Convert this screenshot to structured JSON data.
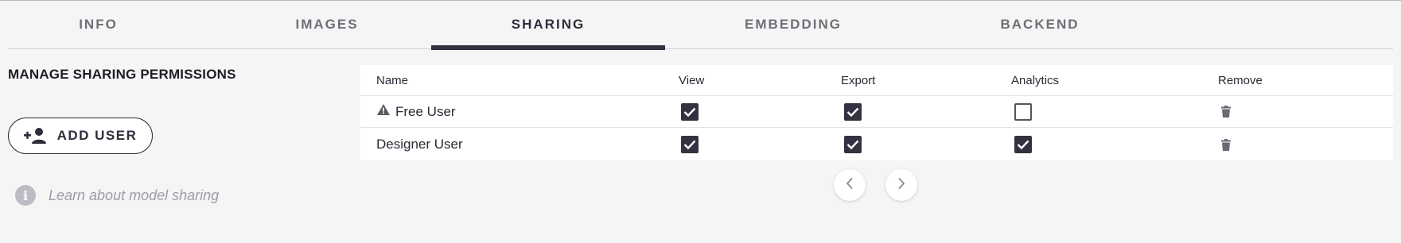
{
  "tabs": [
    {
      "label": "INFO",
      "active": false
    },
    {
      "label": "IMAGES",
      "active": false
    },
    {
      "label": "SHARING",
      "active": true
    },
    {
      "label": "EMBEDDING",
      "active": false
    },
    {
      "label": "BACKEND",
      "active": false
    }
  ],
  "sharing": {
    "title": "MANAGE SHARING PERMISSIONS",
    "add_user_label": "ADD USER",
    "add_user_icon": "person-add-icon",
    "learn_link": "Learn about model sharing",
    "learn_icon": "info-icon"
  },
  "table": {
    "headers": {
      "name": "Name",
      "view": "View",
      "export": "Export",
      "analytics": "Analytics",
      "remove": "Remove"
    },
    "rows": [
      {
        "name": "Free User",
        "warning_icon": "warning-icon",
        "view": true,
        "export": true,
        "analytics": false
      },
      {
        "name": "Designer User",
        "view": true,
        "export": true,
        "analytics": true
      }
    ]
  },
  "pagination": {
    "prev_icon": "chevron-left-icon",
    "next_icon": "chevron-right-icon"
  },
  "colors": {
    "accent": "#333240",
    "background": "#f5f5f5",
    "muted_text": "#9d9ca8"
  }
}
